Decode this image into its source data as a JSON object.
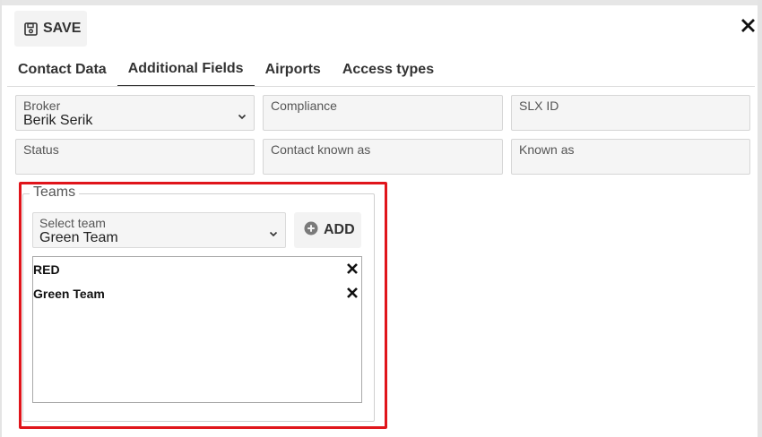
{
  "toolbar": {
    "save_label": "SAVE"
  },
  "tabs": [
    {
      "label": "Contact Data",
      "active": false
    },
    {
      "label": "Additional Fields",
      "active": true
    },
    {
      "label": "Airports",
      "active": false
    },
    {
      "label": "Access types",
      "active": false
    }
  ],
  "fields": {
    "broker": {
      "label": "Broker",
      "value": "Berik Serik"
    },
    "compliance": {
      "label": "Compliance",
      "value": ""
    },
    "slx_id": {
      "label": "SLX ID",
      "value": ""
    },
    "status": {
      "label": "Status",
      "value": ""
    },
    "contact_known_as": {
      "label": "Contact known as",
      "value": ""
    },
    "known_as": {
      "label": "Known as",
      "value": ""
    }
  },
  "teams": {
    "legend": "Teams",
    "select_label": "Select team",
    "select_value": "Green Team",
    "add_label": "ADD",
    "items": [
      {
        "name": "RED"
      },
      {
        "name": "Green Team"
      }
    ]
  },
  "colors": {
    "highlight": "#e0151b",
    "field_bg": "#f5f5f5",
    "button_bg": "#f3f3f3"
  },
  "icons": {
    "save": "floppy-disk-icon",
    "close": "close-icon",
    "dropdown": "chevron-down-icon",
    "add": "plus-circle-icon",
    "remove": "remove-x-icon"
  }
}
